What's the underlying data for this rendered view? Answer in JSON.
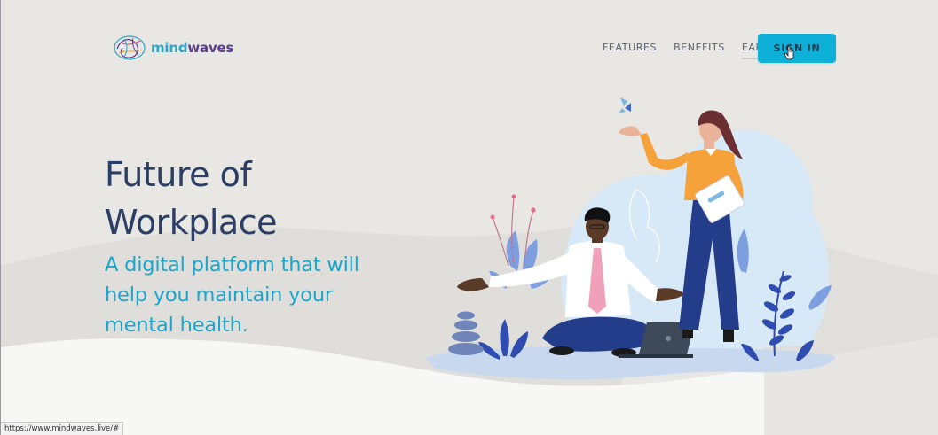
{
  "brand": {
    "name_part1": "mind",
    "name_part2": "waves",
    "color_primary": "#2aa6c8",
    "color_secondary": "#5a3f8e",
    "logo_icon": "brain-logo-icon"
  },
  "nav": {
    "items": [
      {
        "label": "FEATURES"
      },
      {
        "label": "BENEFITS"
      },
      {
        "label": "EAP"
      }
    ],
    "active_item": "EAP",
    "signin_label": "SIGN IN",
    "signin_color": "#0fb0d8"
  },
  "hero": {
    "title_line1": "Future of",
    "title_line2": "Workplace",
    "subtitle": "A digital platform that will help you maintain your mental health.",
    "title_color": "#2b3f66",
    "subtitle_color": "#1ba6cc"
  },
  "illustration": {
    "name": "mental-wellness-illustration"
  },
  "status_bar": {
    "url": "https://www.mindwaves.live/#"
  }
}
